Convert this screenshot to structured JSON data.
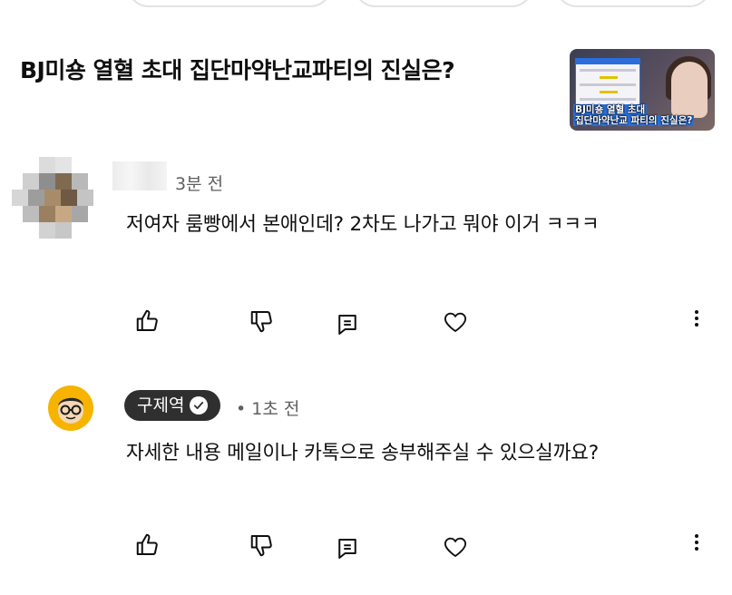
{
  "video": {
    "title": "BJ미숑 열혈 초대 집단마약난교파티의 진실은?",
    "thumbnail_caption_line1": "BJ미숑 열혈 초대",
    "thumbnail_caption_line2": "집단마약난교 파티의 진실은?"
  },
  "comments": [
    {
      "author": "",
      "time": "3분 전",
      "text": "저여자 룸빵에서 본애인데? 2차도 나가고 뭐야 이거 ㅋㅋㅋ"
    },
    {
      "author": "구제역",
      "verified": true,
      "time": "• 1초 전",
      "text": "자세한 내용 메일이나 카톡으로 송부해주실 수 있으실까요?"
    }
  ],
  "actions": {
    "like": "thumbs-up-icon",
    "dislike": "thumbs-down-icon",
    "reply": "reply-icon",
    "heart": "heart-icon",
    "more": "more-vert-icon"
  },
  "colors": {
    "text": "#0f0f0f",
    "meta": "#606060",
    "badge_bg": "#2f2f2f",
    "avatar_yellow": "#f6b400"
  }
}
